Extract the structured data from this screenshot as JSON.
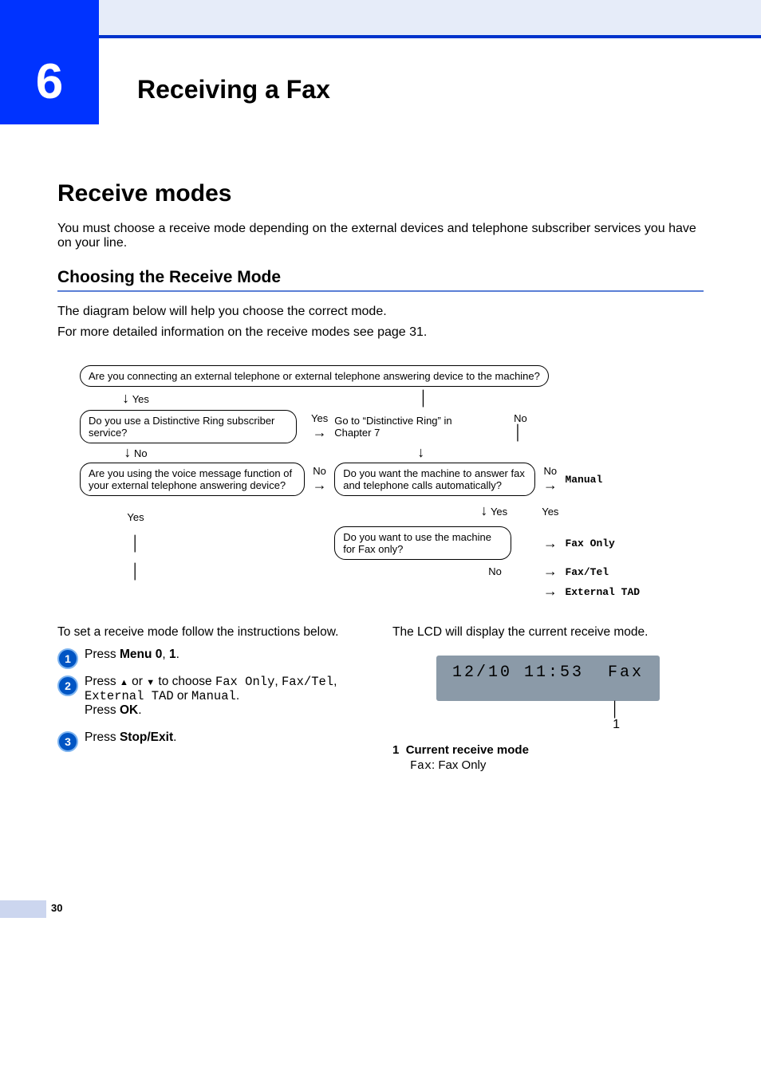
{
  "chapter": {
    "number": "6",
    "title": "Receiving a Fax"
  },
  "section": {
    "title": "Receive modes"
  },
  "lead": "You must choose a receive mode depending on the external devices and telephone subscriber services you have on your line.",
  "subsection": {
    "title": "Choosing the Receive Mode"
  },
  "p1": "The diagram below will help you choose the correct mode.",
  "p2": "For more detailed information on the receive modes see page 31.",
  "diagram": {
    "q1": "Are you connecting an external telephone or external telephone answering device to the machine?",
    "yes": "Yes",
    "no": "No",
    "q2": "Do you use a Distinctive Ring subscriber service?",
    "goto": "Go to “Distinctive Ring” in Chapter 7",
    "q3": "Are you using the voice message function of your external telephone answering device?",
    "q4": "Do you want the machine to answer fax and telephone calls automatically?",
    "q5": "Do you want to use the machine for Fax only?",
    "mode_manual": "Manual",
    "mode_faxonly": "Fax Only",
    "mode_faxtel": "Fax/Tel",
    "mode_exttad": "External TAD"
  },
  "instructions_intro": "To set a receive mode follow the instructions below.",
  "steps": {
    "s1_a": "Press ",
    "s1_b": "Menu 0",
    "s1_c": ", ",
    "s1_d": "1",
    "s1_e": ".",
    "s2_a": "Press ",
    "s2_up": "▲",
    "s2_b": " or ",
    "s2_down": "▼",
    "s2_c": " to choose ",
    "s2_opt1": "Fax Only",
    "s2_d": ", ",
    "s2_opt2": "Fax/Tel",
    "s2_e": ", ",
    "s2_opt3": "External TAD",
    "s2_f": " or ",
    "s2_opt4": "Manual",
    "s2_g": ".",
    "s2_h": "Press ",
    "s2_i": "OK",
    "s2_j": ".",
    "s3_a": "Press ",
    "s3_b": "Stop/Exit",
    "s3_c": "."
  },
  "right": {
    "intro": "The LCD will display the current receive mode.",
    "lcd": "12/10 11:53  Fax",
    "callout": "1",
    "legend_num": "1",
    "legend_title": "Current receive mode",
    "legend_code": "Fax",
    "legend_rest": ": Fax Only"
  },
  "page_number": "30"
}
